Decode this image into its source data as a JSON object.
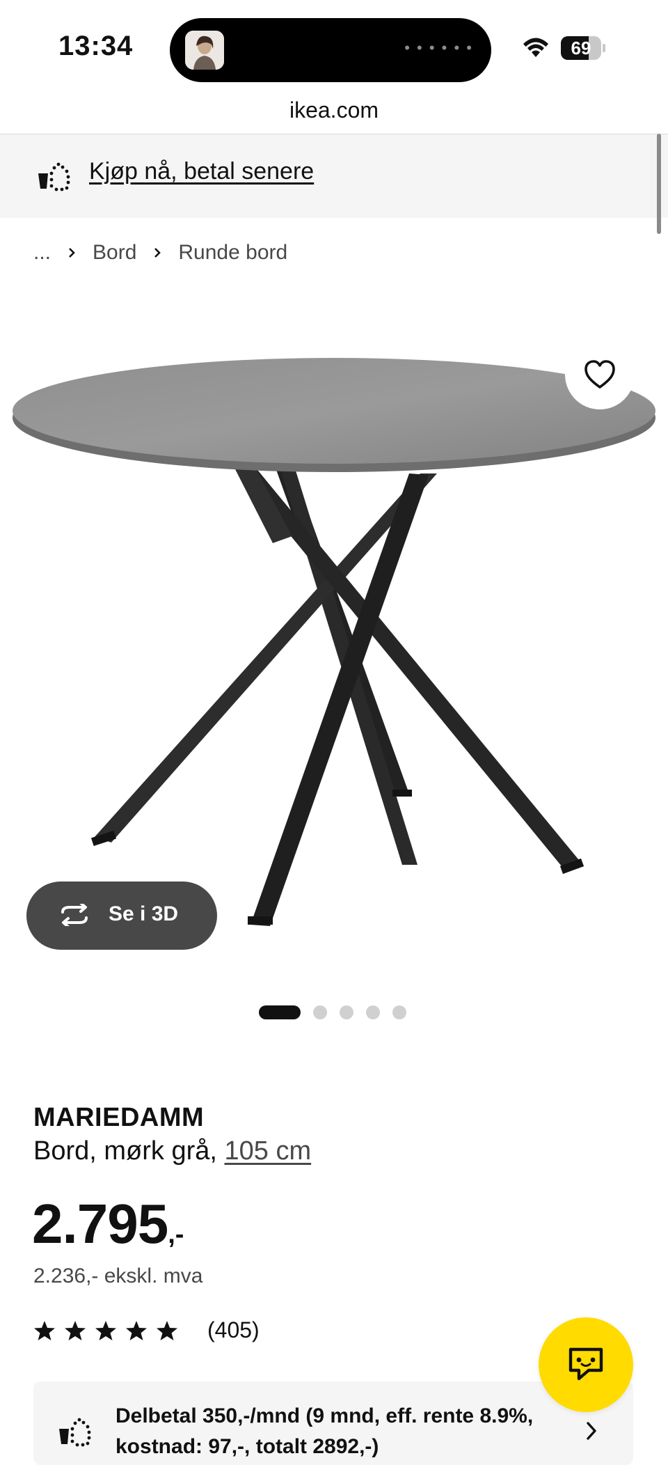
{
  "status_bar": {
    "time": "13:34",
    "battery": "69",
    "battery_level": 0.69
  },
  "browser": {
    "url": "ikea.com"
  },
  "banner": {
    "text": "Kjøp nå, betal senere"
  },
  "breadcrumb": {
    "items": [
      "...",
      "Bord",
      "Runde bord"
    ]
  },
  "gallery": {
    "see_3d_label": "Se i 3D",
    "slide_count": 5,
    "active_slide": 1
  },
  "product": {
    "name": "MARIEDAMM",
    "description": "Bord, mørk grå, ",
    "size": "105 cm",
    "price": "2.795",
    "price_suffix": ",-",
    "price_excl_vat": "2.236,- ekskl. mva",
    "rating_stars": 5,
    "rating_count": "(405)"
  },
  "payment": {
    "text": "Delbetal 350,-/mnd (9 mnd, eff. rente 8.9%, kostnad: 97,-, totalt 2892,-)"
  },
  "colors": {
    "ikea_yellow": "#ffdb00",
    "dark_button": "#484848",
    "table_top": "#8a8a8a",
    "table_legs": "#262626"
  },
  "icons": {
    "wifi": "wifi-icon",
    "heart": "heart-icon",
    "rotate": "rotate-3d-icon",
    "chat": "chat-icon",
    "pay_later": "cart-dots-icon",
    "chevron": "chevron-right-icon"
  }
}
